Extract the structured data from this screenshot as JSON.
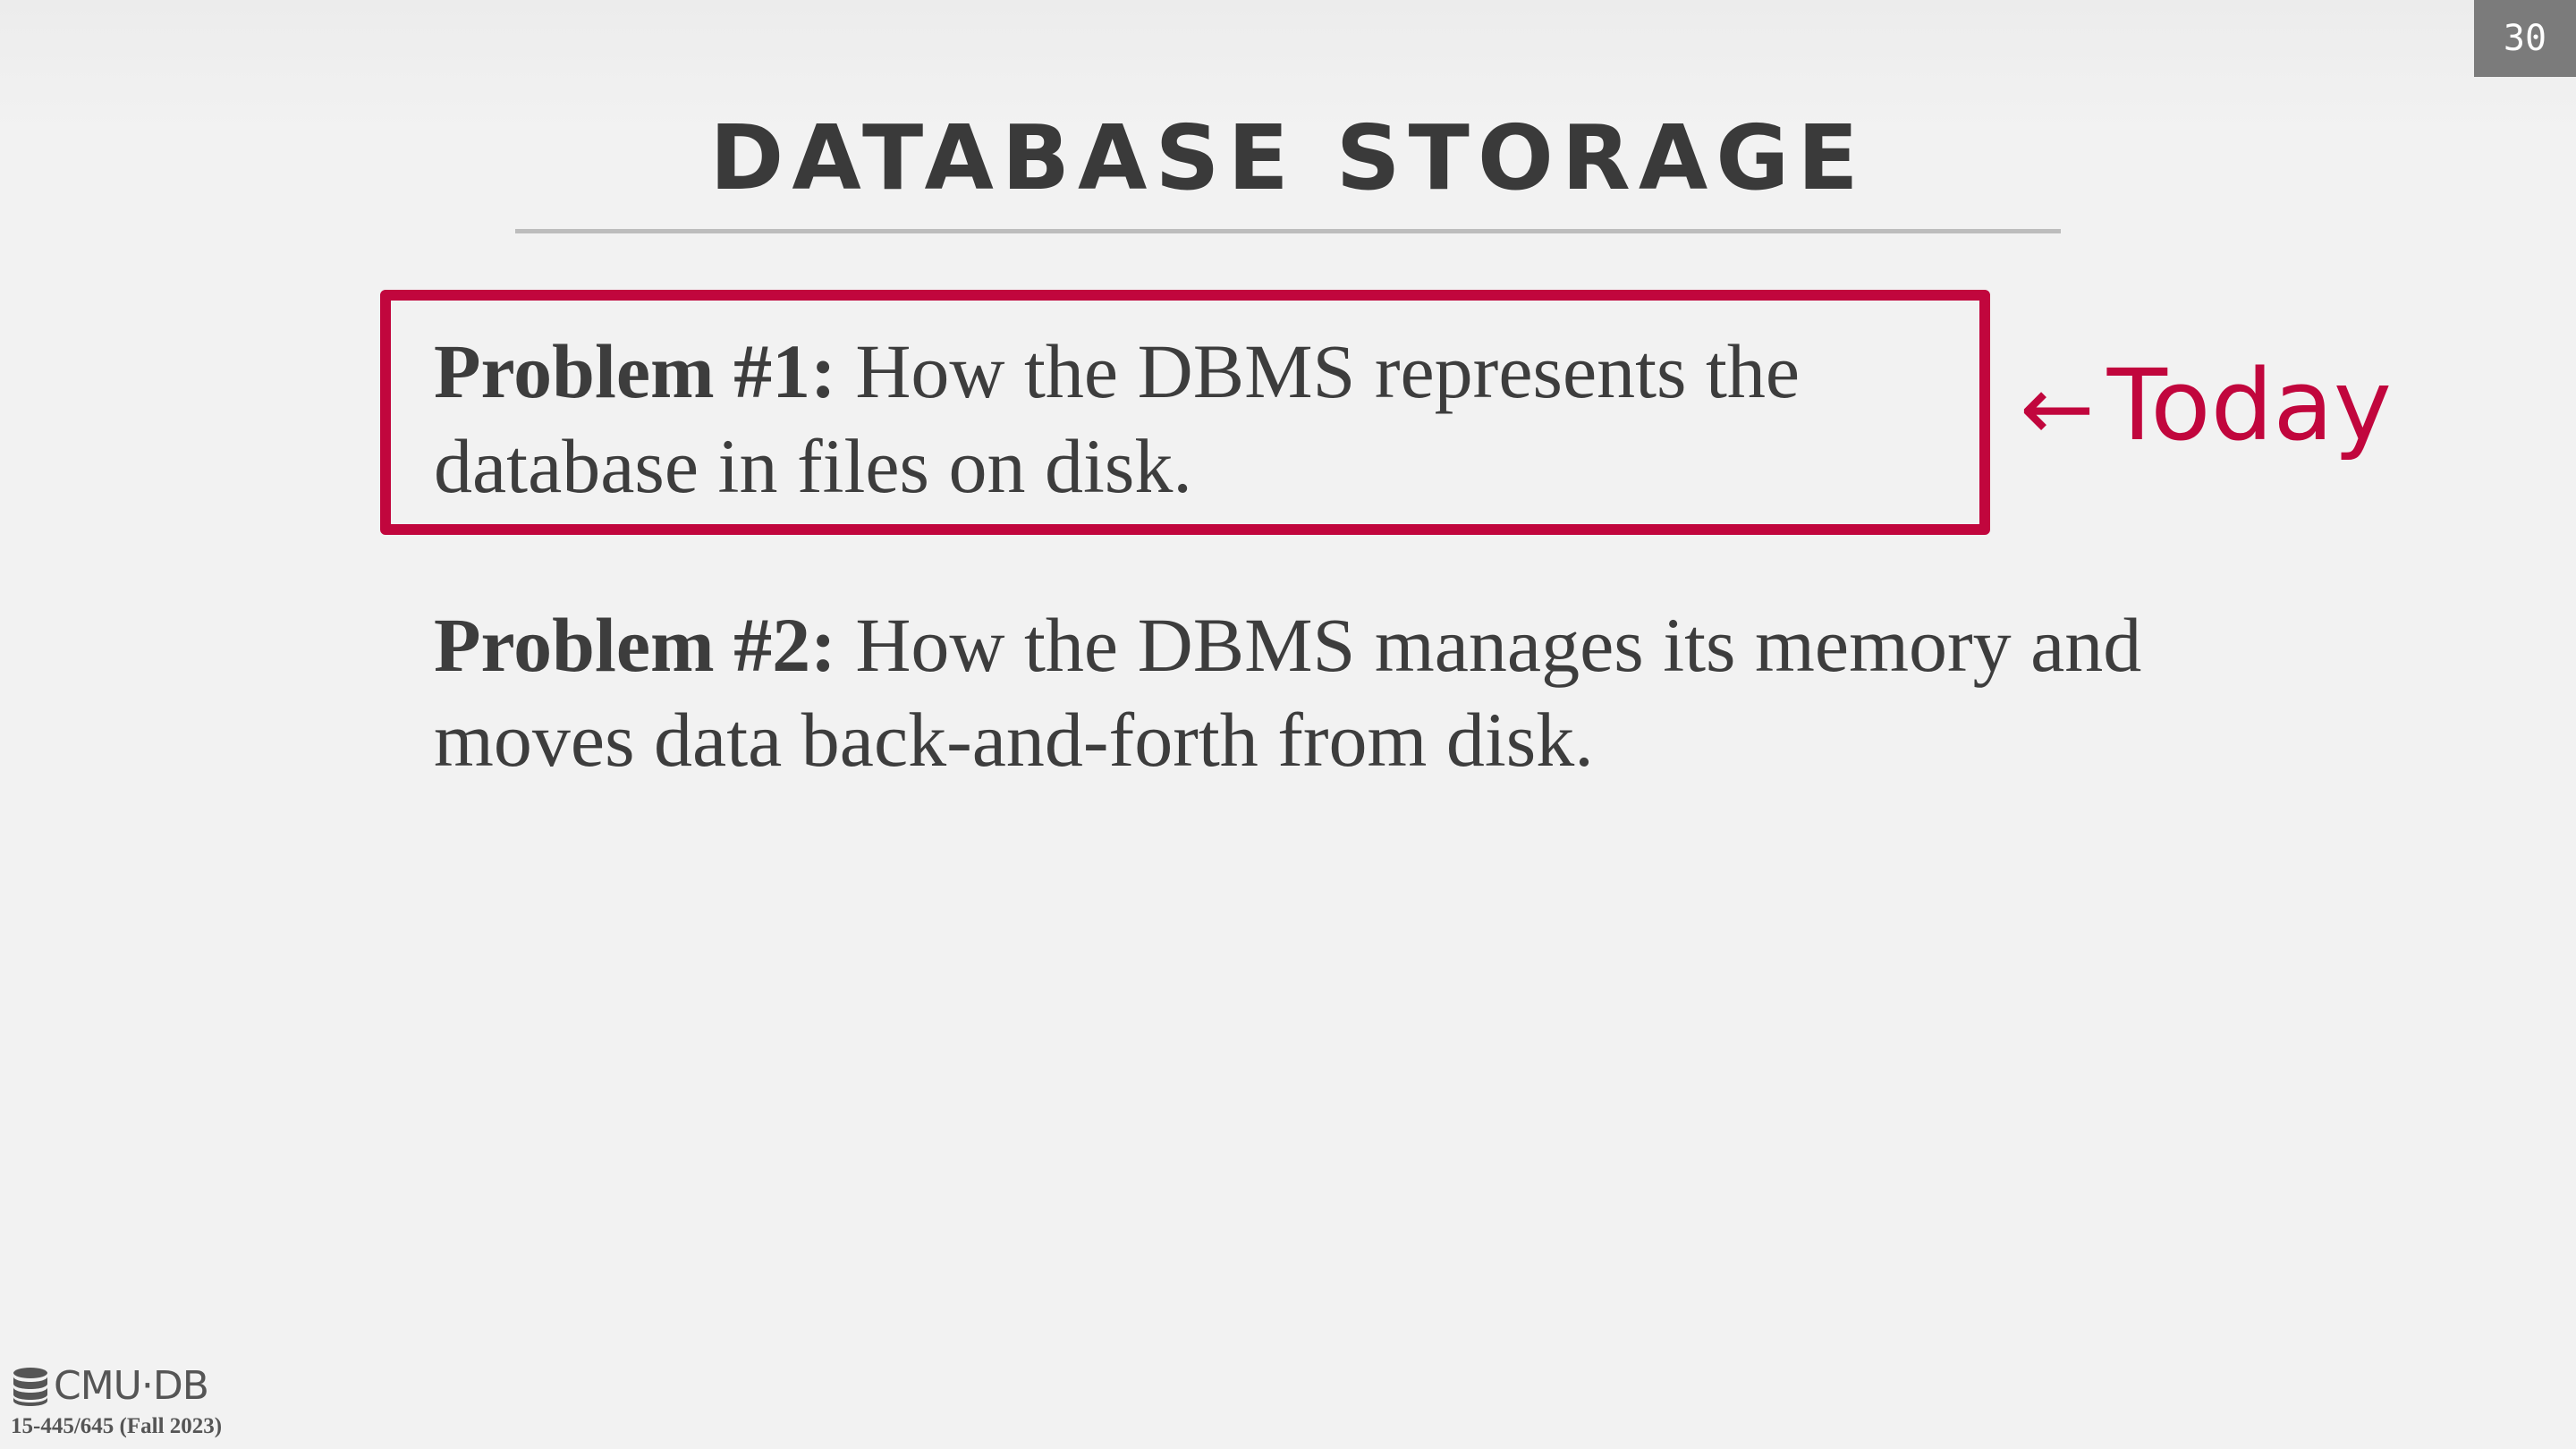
{
  "slide": {
    "page_number": "30",
    "title": "DATABASE STORAGE"
  },
  "problems": [
    {
      "label": "Problem #1:",
      "text": " How the DBMS represents the database in files on disk.",
      "highlighted": true
    },
    {
      "label": "Problem #2:",
      "text": " How the DBMS manages its memory and moves data back-and-forth from disk.",
      "highlighted": false
    }
  ],
  "callout": {
    "arrow": "←",
    "text": "Today"
  },
  "footer": {
    "logo_text": "CMU·DB",
    "logo_icon": "database-icon",
    "course": "15-445/645 (Fall 2023)"
  },
  "colors": {
    "accent": "#c1063d",
    "text": "#3d3d3d",
    "background": "#f2f2f2",
    "page_number_bg": "#7b7b7b"
  }
}
